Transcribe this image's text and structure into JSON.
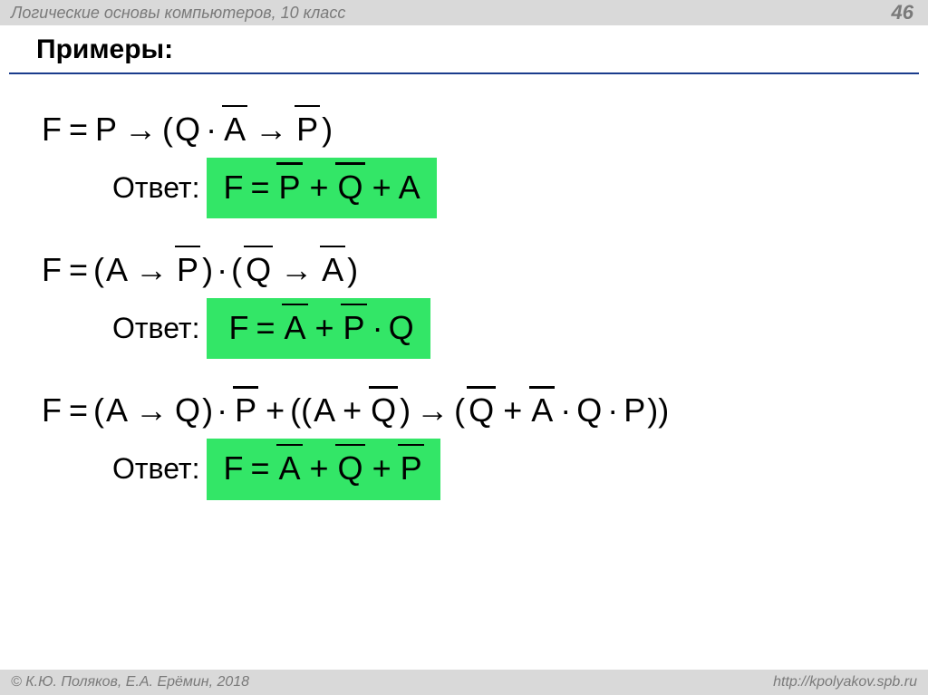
{
  "header": {
    "course_title": "Логические основы компьютеров, 10 класс",
    "page_number": "46"
  },
  "title": "Примеры:",
  "labels": {
    "answer": "Ответ:"
  },
  "vars": {
    "F": "F",
    "P": "P",
    "Q": "Q",
    "A": "A"
  },
  "ops": {
    "eq": "=",
    "arrow": "→",
    "dot": "·",
    "plus": "+",
    "lp": "(",
    "rp": ")"
  },
  "footer": {
    "left": "© К.Ю. Поляков, Е.А. Ерёмин, 2018",
    "right": "http://kpolyakov.spb.ru"
  },
  "examples_readable": [
    {
      "formula": "F = P → (Q · ¬A → ¬P)",
      "answer": "F = ¬P + ¬Q + A"
    },
    {
      "formula": "F = (A → ¬P) · (¬Q → ¬A)",
      "answer": "F = ¬A + ¬P · Q"
    },
    {
      "formula": "F = (A → Q) · ¬P + ((A + ¬Q) → (¬Q + ¬A · Q · P))",
      "answer": "F = ¬A + ¬Q + ¬P"
    }
  ]
}
